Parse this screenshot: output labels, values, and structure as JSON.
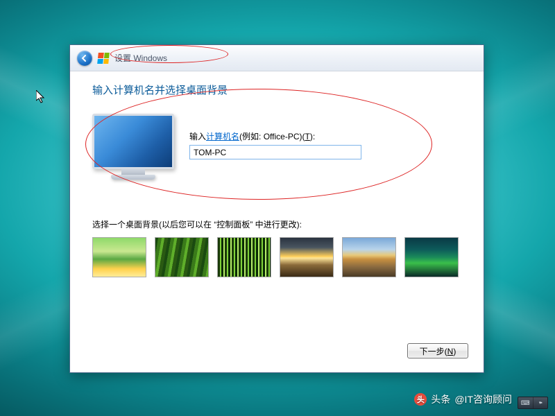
{
  "header": {
    "title": "设置 Windows"
  },
  "page": {
    "heading": "输入计算机名并选择桌面背景"
  },
  "computer_name": {
    "label_prefix": "输入",
    "label_link": "计算机名",
    "label_suffix": "(例如: Office-PC)(",
    "label_accel": "T",
    "label_end": "):",
    "value": "TOM-PC"
  },
  "wallpaper": {
    "instruction": "选择一个桌面背景(以后您可以在 “控制面板” 中进行更改):"
  },
  "buttons": {
    "next": "下一步(",
    "next_accel": "N",
    "next_end": ")"
  },
  "watermark": {
    "prefix": "头条",
    "handle": "@IT咨询顾问"
  }
}
